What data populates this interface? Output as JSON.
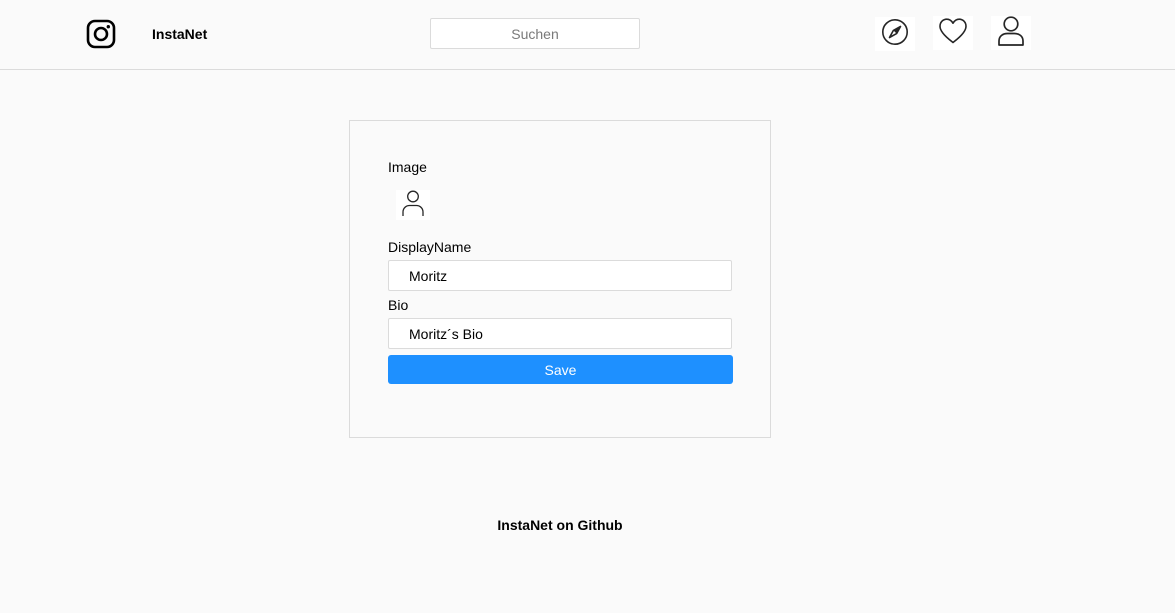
{
  "header": {
    "brand": "InstaNet",
    "search_placeholder": "Suchen",
    "nav_icons": [
      "explore-icon",
      "heart-icon",
      "profile-icon"
    ]
  },
  "form": {
    "image_label": "Image",
    "display_name_label": "DisplayName",
    "display_name_value": "Moritz",
    "bio_label": "Bio",
    "bio_value": "Moritz´s Bio",
    "save_label": "Save"
  },
  "footer": {
    "github_link": "InstaNet on Github"
  },
  "colors": {
    "accent": "#1e90ff",
    "background": "#fafafa",
    "border": "#dbdbdb"
  }
}
